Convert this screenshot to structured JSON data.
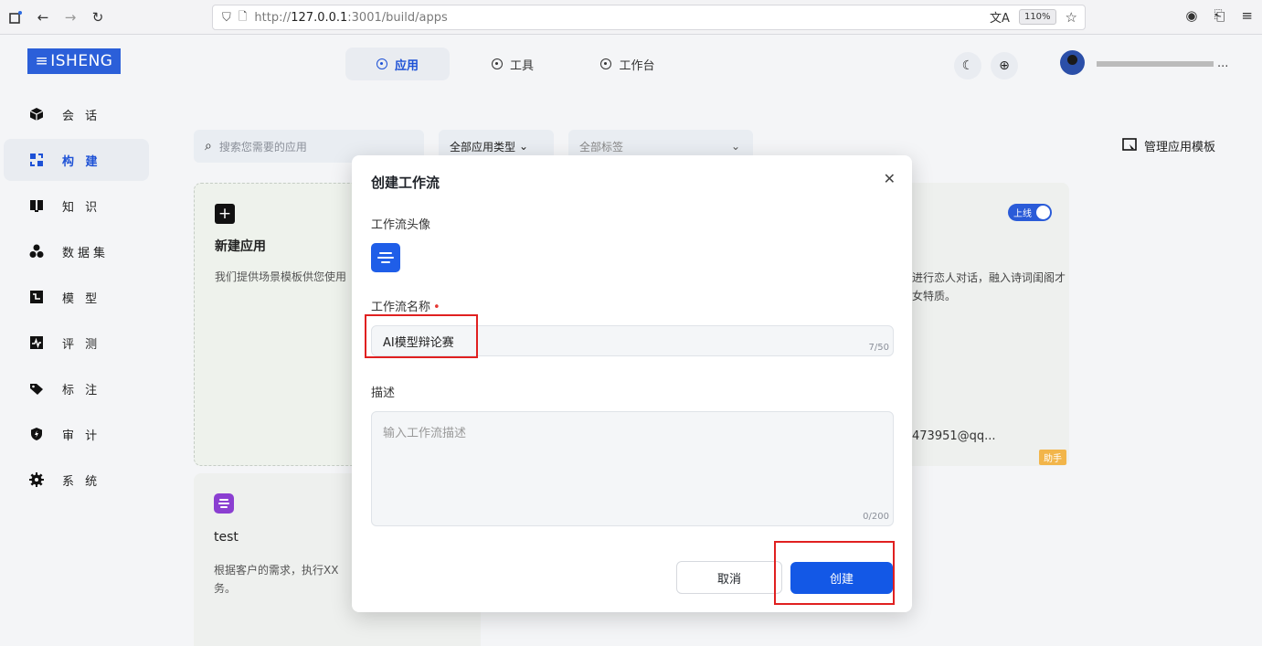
{
  "browser": {
    "url_prefix": "http://",
    "url_host": "127.0.0.1",
    "url_rest": ":3001/build/apps",
    "zoom": "110%"
  },
  "header": {
    "logo": "ISHENG",
    "tabs": [
      {
        "label": "应用",
        "active": true
      },
      {
        "label": "工具",
        "active": false
      },
      {
        "label": "工作台",
        "active": false
      }
    ],
    "user_name": "..."
  },
  "sidebar": {
    "items": [
      {
        "label": "会 话",
        "icon": "cube-icon"
      },
      {
        "label": "构 建",
        "icon": "build-icon",
        "active": true
      },
      {
        "label": "知 识",
        "icon": "book-icon"
      },
      {
        "label": "数据集",
        "icon": "dataset-icon"
      },
      {
        "label": "模 型",
        "icon": "model-icon"
      },
      {
        "label": "评 测",
        "icon": "evaluation-icon"
      },
      {
        "label": "标 注",
        "icon": "tag-icon"
      },
      {
        "label": "审 计",
        "icon": "shield-icon"
      },
      {
        "label": "系 统",
        "icon": "gear-icon"
      }
    ]
  },
  "toolbar": {
    "search_placeholder": "搜索您需要的应用",
    "filter_type": "全部应用类型",
    "filter_tag": "全部标签",
    "manage_templates": "管理应用模板"
  },
  "cards": {
    "new_app_title": "新建应用",
    "new_app_desc": "我们提供场景模板供您使用",
    "right_toggle": "上线",
    "right_desc": "进行恋人对话，融入诗词闺阁才女特质。",
    "right_mail": "473951@qq...",
    "right_tag": "助手",
    "test_title": "test",
    "test_desc": "根据客户的需求，执行XX务。"
  },
  "modal": {
    "title": "创建工作流",
    "avatar_label": "工作流头像",
    "name_label": "工作流名称",
    "name_value": "AI模型辩论赛",
    "name_count": "7/50",
    "desc_label": "描述",
    "desc_placeholder": "输入工作流描述",
    "desc_count": "0/200",
    "cancel": "取消",
    "create": "创建"
  },
  "colors": {
    "primary": "#1358e6",
    "annotation": "#e02020"
  }
}
